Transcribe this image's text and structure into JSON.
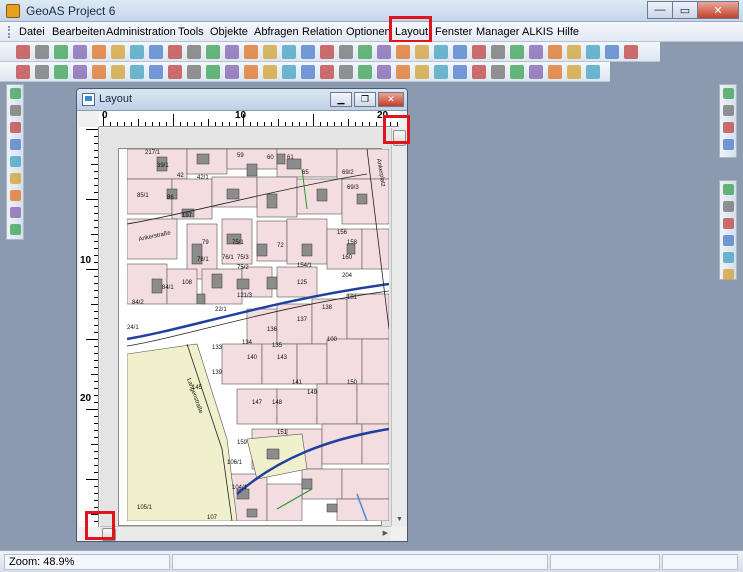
{
  "window": {
    "title": "GeoAS Project 6"
  },
  "menu": {
    "items": [
      "Datei",
      "Bearbeiten",
      "Administration",
      "Tools",
      "Objekte",
      "Abfragen",
      "Relation",
      "Optionen",
      "Layout",
      "Fenster",
      "Manager",
      "ALKIS",
      "Hilfe"
    ],
    "highlighted": "Layout"
  },
  "layout_window": {
    "title": "Layout",
    "ruler_top_labels": [
      "0",
      "10",
      "20"
    ],
    "ruler_left_labels": [
      "10",
      "20"
    ]
  },
  "map_labels": {
    "parcels": [
      "217/1",
      "39/1",
      "42",
      "42/1",
      "59",
      "60",
      "61",
      "65",
      "69/2",
      "69/3",
      "85/1",
      "86",
      "197",
      "79",
      "75/1",
      "75/3",
      "72",
      "156",
      "158",
      "160",
      "78/1",
      "76/1",
      "75/2",
      "154/1",
      "204",
      "84/1",
      "121/3",
      "125",
      "181",
      "136",
      "137",
      "133",
      "134",
      "135",
      "138",
      "100",
      "139",
      "143",
      "140",
      "141",
      "145",
      "147",
      "148",
      "149",
      "150",
      "151",
      "159",
      "104/1",
      "106/1",
      "105/1",
      "107",
      "108",
      "84/2",
      "24/1",
      "22/1"
    ],
    "streets": [
      "Ankerstraße",
      "Ankerplatz",
      "Langenstraße"
    ]
  },
  "status": {
    "zoom": "Zoom: 48.9%"
  },
  "colors": {
    "highlight": "#e0141e",
    "desktop": "#8c9ab0",
    "parcel": "#f3dde0",
    "field": "#f1f0cc",
    "road": "#2040a0"
  }
}
